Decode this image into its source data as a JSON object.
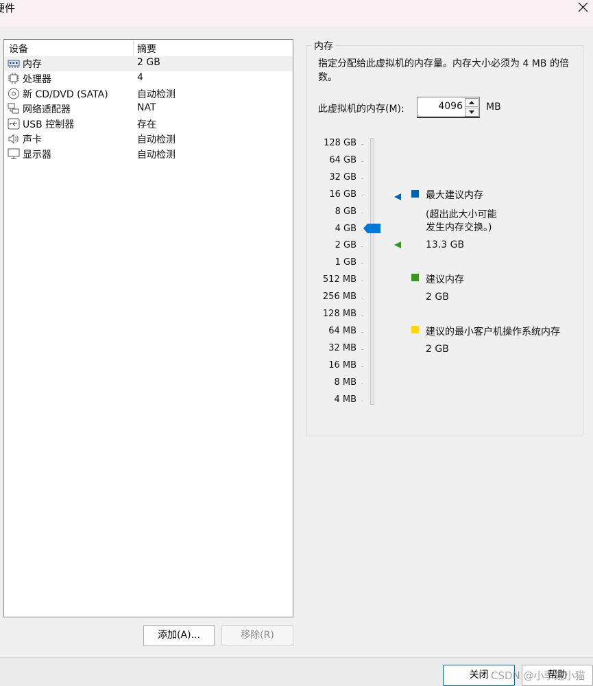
{
  "window": {
    "title": "硬件"
  },
  "device_list": {
    "columns": [
      "设备",
      "摘要"
    ],
    "rows": [
      {
        "name": "内存",
        "summary": "2 GB",
        "icon": "memory-icon",
        "selected": true
      },
      {
        "name": "处理器",
        "summary": "4",
        "icon": "cpu-icon"
      },
      {
        "name": "新 CD/DVD (SATA)",
        "summary": "自动检测",
        "icon": "cd-dvd-icon"
      },
      {
        "name": "网络适配器",
        "summary": "NAT",
        "icon": "network-adapter-icon"
      },
      {
        "name": "USB 控制器",
        "summary": "存在",
        "icon": "usb-icon"
      },
      {
        "name": "声卡",
        "summary": "自动检测",
        "icon": "speaker-icon"
      },
      {
        "name": "显示器",
        "summary": "自动检测",
        "icon": "monitor-icon"
      }
    ],
    "add_button": "添加(A)...",
    "remove_button": "移除(R)"
  },
  "memory": {
    "group_title": "内存",
    "description": "指定分配给此虚拟机的内存量。内存大小必须为 4 MB 的倍数。",
    "field_label": "此虚拟机的内存(M):",
    "value": "4096",
    "unit": "MB",
    "slider_labels": [
      "128 GB",
      "64 GB",
      "32 GB",
      "16 GB",
      "8 GB",
      "4 GB",
      "2 GB",
      "1 GB",
      "512 MB",
      "256 MB",
      "128 MB",
      "64 MB",
      "32 MB",
      "16 MB",
      "8 MB",
      "4 MB"
    ],
    "slider_value": "4 GB",
    "legend": {
      "max_recommended": "最大建议内存",
      "max_note_1": "(超出此大小可能",
      "max_note_2": "发生内存交换。)",
      "max_value": "13.3 GB",
      "recommended": "建议内存",
      "recommended_value": "2 GB",
      "min_guest": "建议的最小客户机操作系统内存",
      "min_guest_value": "2 GB"
    },
    "colors": {
      "max": "#0063b1",
      "recommended": "#3a961f",
      "min_guest": "#ffd800",
      "thumb": "#0078d7"
    }
  },
  "footer": {
    "close_button": "关闭",
    "help_button": "帮助",
    "watermark": "CSDN @小李是小猫"
  }
}
